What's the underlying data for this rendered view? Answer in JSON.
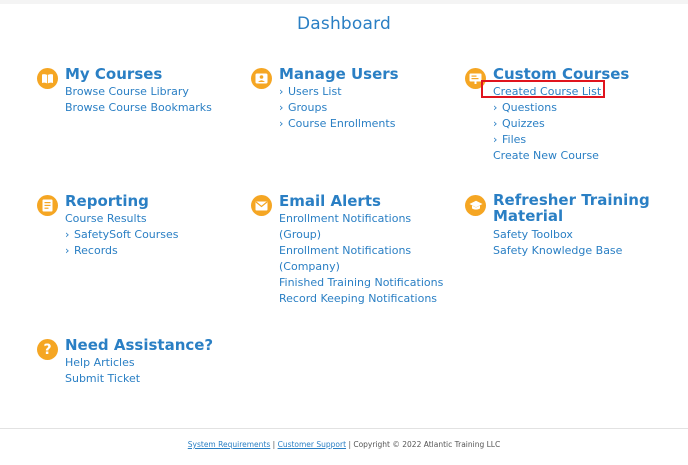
{
  "page": {
    "title": "Dashboard"
  },
  "colors": {
    "accent": "#2a7fc4",
    "icon_bg": "#f5a623",
    "highlight": "#e0141e"
  },
  "sections": {
    "my_courses": {
      "title": "My Courses",
      "icon": "book-icon",
      "links": [
        "Browse Course Library",
        "Browse Course Bookmarks"
      ]
    },
    "manage_users": {
      "title": "Manage Users",
      "icon": "user-card-icon",
      "links": [
        "Users List",
        "Groups",
        "Course Enrollments"
      ]
    },
    "custom_courses": {
      "title": "Custom Courses",
      "icon": "course-board-icon",
      "links": [
        "Created Course List",
        "Questions",
        "Quizzes",
        "Files",
        "Create New Course"
      ]
    },
    "reporting": {
      "title": "Reporting",
      "icon": "report-icon",
      "links": [
        "Course Results",
        "SafetySoft Courses",
        "Records"
      ]
    },
    "email_alerts": {
      "title": "Email Alerts",
      "icon": "envelope-icon",
      "links": [
        "Enrollment Notifications",
        "(Group)",
        "Enrollment Notifications",
        "(Company)",
        "Finished Training Notifications",
        "Record Keeping Notifications"
      ]
    },
    "refresher": {
      "title_line1": "Refresher Training",
      "title_line2": "Material",
      "icon": "graduation-cap-icon",
      "links": [
        "Safety Toolbox",
        "Safety Knowledge Base"
      ]
    },
    "assistance": {
      "title": "Need Assistance?",
      "icon": "question-icon",
      "links": [
        "Help Articles",
        "Submit Ticket"
      ]
    }
  },
  "footer": {
    "system_requirements": "System Requirements",
    "sep": "|",
    "customer_support": "Customer Support",
    "copyright": "| Copyright © 2022 Atlantic Training LLC"
  }
}
